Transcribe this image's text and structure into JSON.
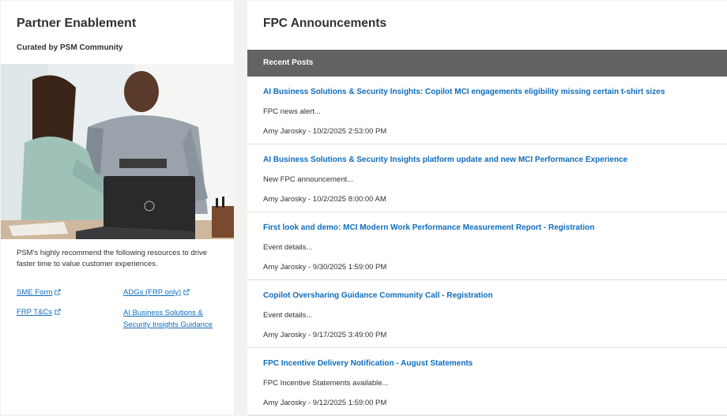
{
  "left": {
    "title": "Partner Enablement",
    "subtitle": "Curated by PSM Community",
    "image_alt": "Two colleagues smiling at a laptop",
    "description": "PSM's highly recommend the following resources to drive faster time to value customer experiences.",
    "links": [
      {
        "label": "SME Form",
        "icon": "external-link-icon"
      },
      {
        "label": "ADGs (FRP only)",
        "icon": "external-link-icon"
      },
      {
        "label": "FRP T&Cs",
        "icon": "external-link-icon"
      },
      {
        "label": "AI Business Solutions & Security Insights Guidance",
        "line1": "AI Business Solutions &",
        "line2": "Security Insights Guidance"
      }
    ]
  },
  "right": {
    "title": "FPC Announcements",
    "section_label": "Recent Posts",
    "posts": [
      {
        "title": "AI Business Solutions & Security Insights: Copilot MCI engagements eligibility missing certain t-shirt sizes",
        "summary": "FPC news alert...",
        "meta": "Amy Jarosky - 10/2/2025 2:53:00 PM"
      },
      {
        "title": "AI Business Solutions & Security Insights platform update and new MCI Performance Experience",
        "summary": "New FPC announcement...",
        "meta": "Amy Jarosky - 10/2/2025 8:00:00 AM"
      },
      {
        "title": "First look and demo: MCI Modern Work Performance Measurement Report - Registration",
        "summary": "Event details...",
        "meta": "Amy Jarosky - 9/30/2025 1:59:00 PM"
      },
      {
        "title": "Copilot Oversharing Guidance Community Call - Registration",
        "summary": "Event details...",
        "meta": "Amy Jarosky - 9/17/2025 3:49:00 PM"
      },
      {
        "title": "FPC Incentive Delivery Notification - August Statements",
        "summary": "FPC Incentive Statements available...",
        "meta": "Amy Jarosky - 9/12/2025 1:59:00 PM"
      }
    ]
  },
  "colors": {
    "link": "#0f6cbd",
    "bar": "#636363",
    "text": "#323130"
  }
}
